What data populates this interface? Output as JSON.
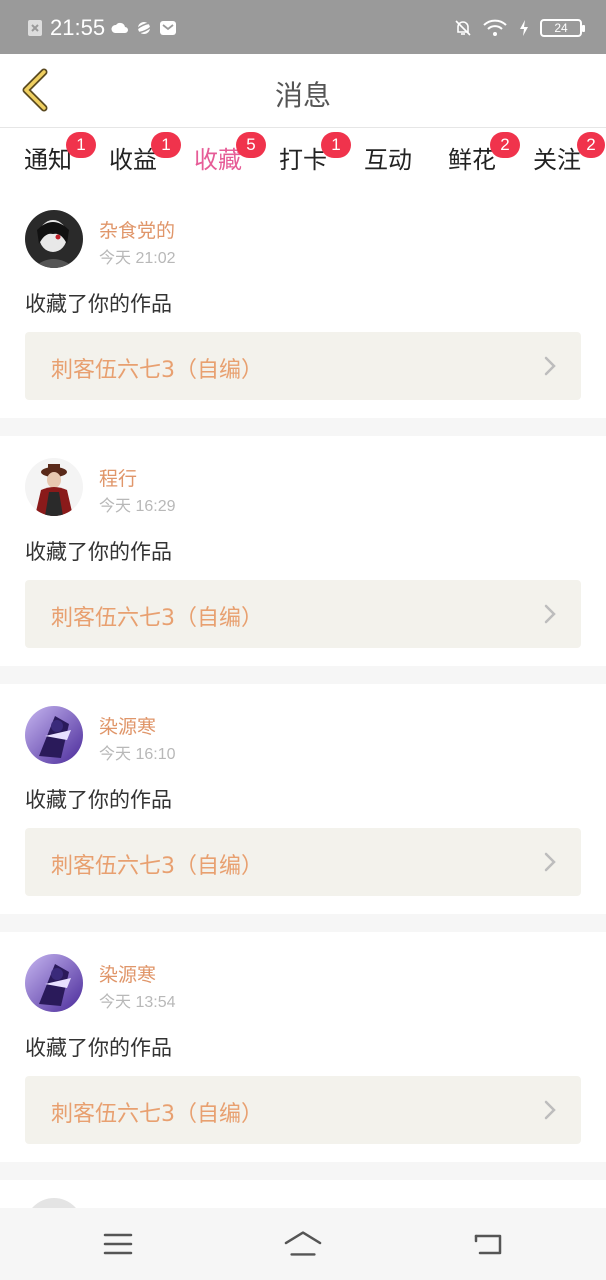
{
  "status_bar": {
    "time": "21:55",
    "battery": "24",
    "icons": [
      "sim-off-icon",
      "cloud-icon",
      "planet-icon",
      "mail-icon",
      "bell-off-icon",
      "wifi-icon",
      "charging-icon"
    ]
  },
  "header": {
    "title": "消息",
    "back_icon": "chevron-left-icon"
  },
  "tabs": [
    {
      "label": "通知",
      "badge": "1"
    },
    {
      "label": "收益",
      "badge": "1"
    },
    {
      "label": "收藏",
      "badge": "5",
      "active": true
    },
    {
      "label": "打卡",
      "badge": "1"
    },
    {
      "label": "互动",
      "badge": ""
    },
    {
      "label": "鲜花",
      "badge": "2"
    },
    {
      "label": "关注",
      "badge": "2"
    }
  ],
  "feed": [
    {
      "user": "杂食党的",
      "time": "今天 21:02",
      "action": "收藏了你的作品",
      "work": "刺客伍六七3（自编）"
    },
    {
      "user": "程行",
      "time": "今天 16:29",
      "action": "收藏了你的作品",
      "work": "刺客伍六七3（自编）"
    },
    {
      "user": "染源寒",
      "time": "今天 16:10",
      "action": "收藏了你的作品",
      "work": "刺客伍六七3（自编）"
    },
    {
      "user": "染源寒",
      "time": "今天 13:54",
      "action": "收藏了你的作品",
      "work": "刺客伍六七3（自编）"
    }
  ],
  "colors": {
    "accent": "#e65c97",
    "badge": "#f0334c",
    "username": "#e0966a",
    "work_title": "#e8a070",
    "work_bg": "#f3f2ec"
  },
  "navbar": {
    "icons": [
      "menu-icon",
      "home-icon",
      "back-icon"
    ]
  }
}
